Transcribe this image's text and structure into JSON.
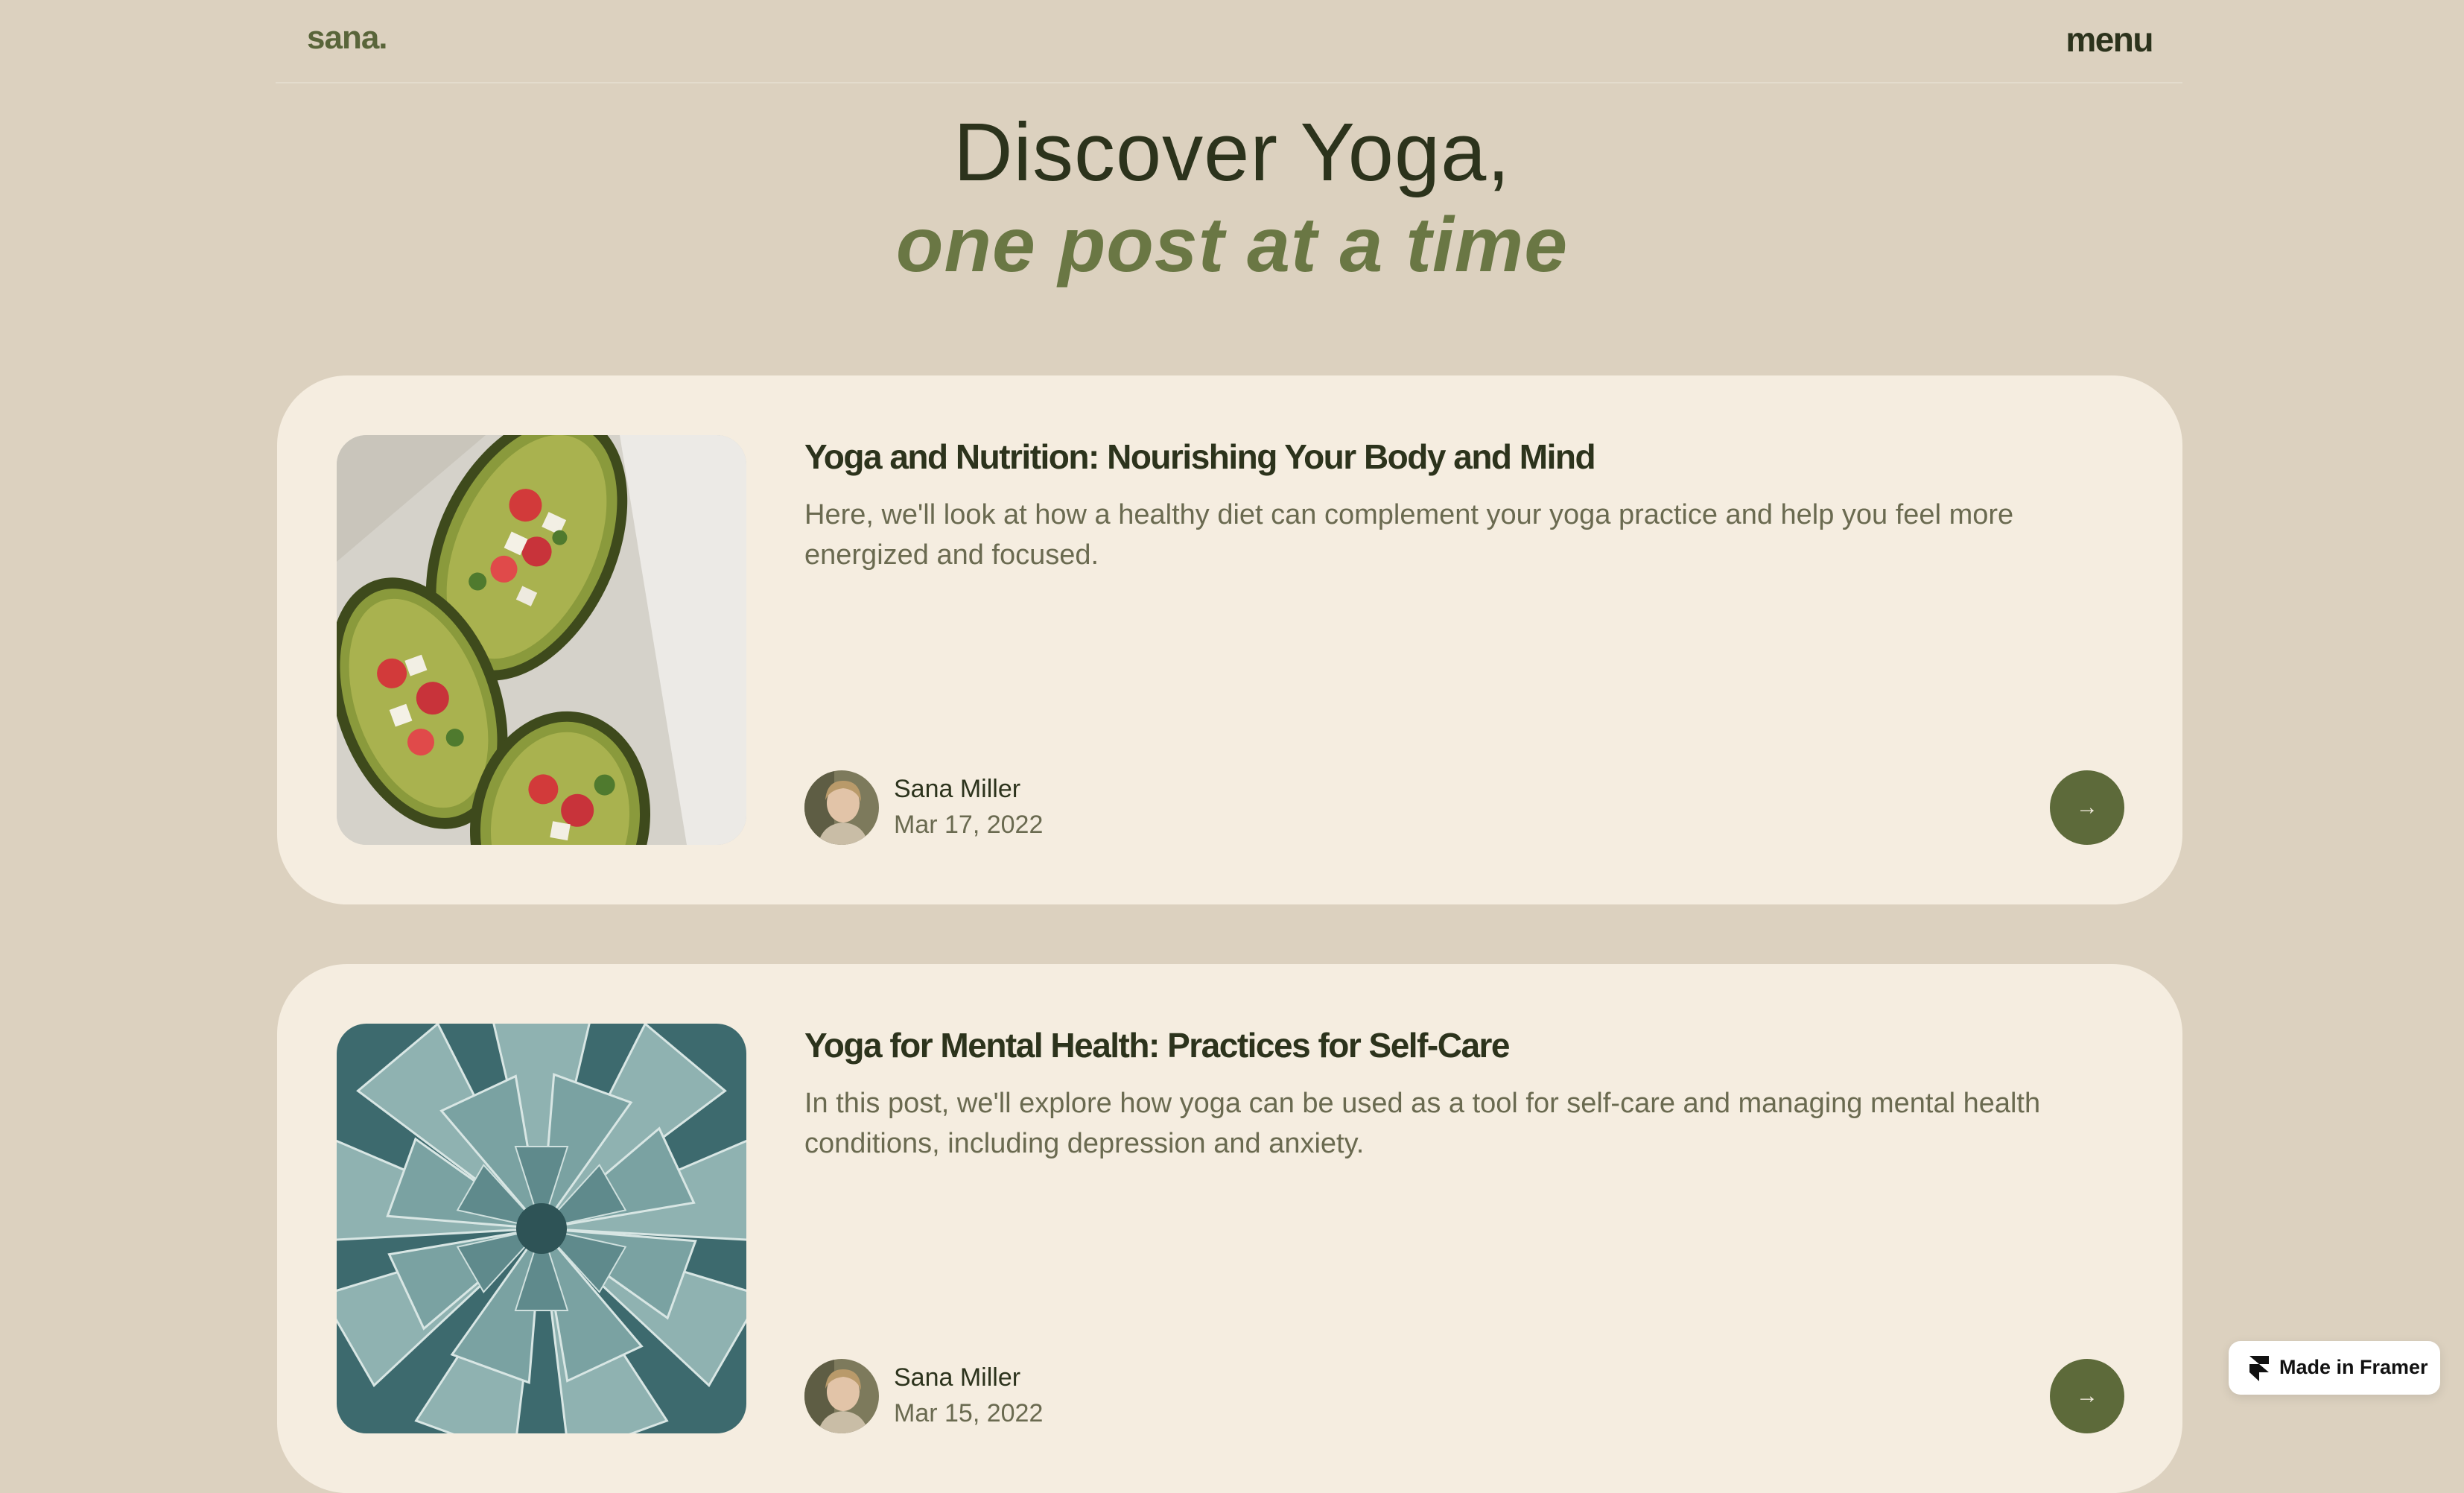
{
  "header": {
    "logo": "sana.",
    "menu_label": "menu"
  },
  "hero": {
    "title": "Discover Yoga,",
    "subtitle": "one post at a time"
  },
  "posts": [
    {
      "title": "Yoga and Nutrition:  Nourishing Your Body and Mind",
      "excerpt": "Here, we'll look at how a healthy diet can complement your yoga practice and help you feel more energized and focused.",
      "author": "Sana Miller",
      "date": "Mar 17, 2022",
      "image": "stuffed-avocado-photo",
      "arrow": "→"
    },
    {
      "title": "Yoga for Mental Health:  Practices for Self-Care",
      "excerpt": "In this post, we'll explore how yoga can be used as a tool for self-care and managing mental health conditions, including depression and anxiety.",
      "author": "Sana Miller",
      "date": "Mar 15, 2022",
      "image": "succulent-photo",
      "arrow": "→"
    }
  ],
  "badge": {
    "label": "Made in Framer"
  },
  "colors": {
    "background": "#dcd1bf",
    "card": "#f5ede0",
    "accent": "#5d6a3a",
    "text_dark": "#2c331c",
    "text_muted": "#6a6a50"
  }
}
